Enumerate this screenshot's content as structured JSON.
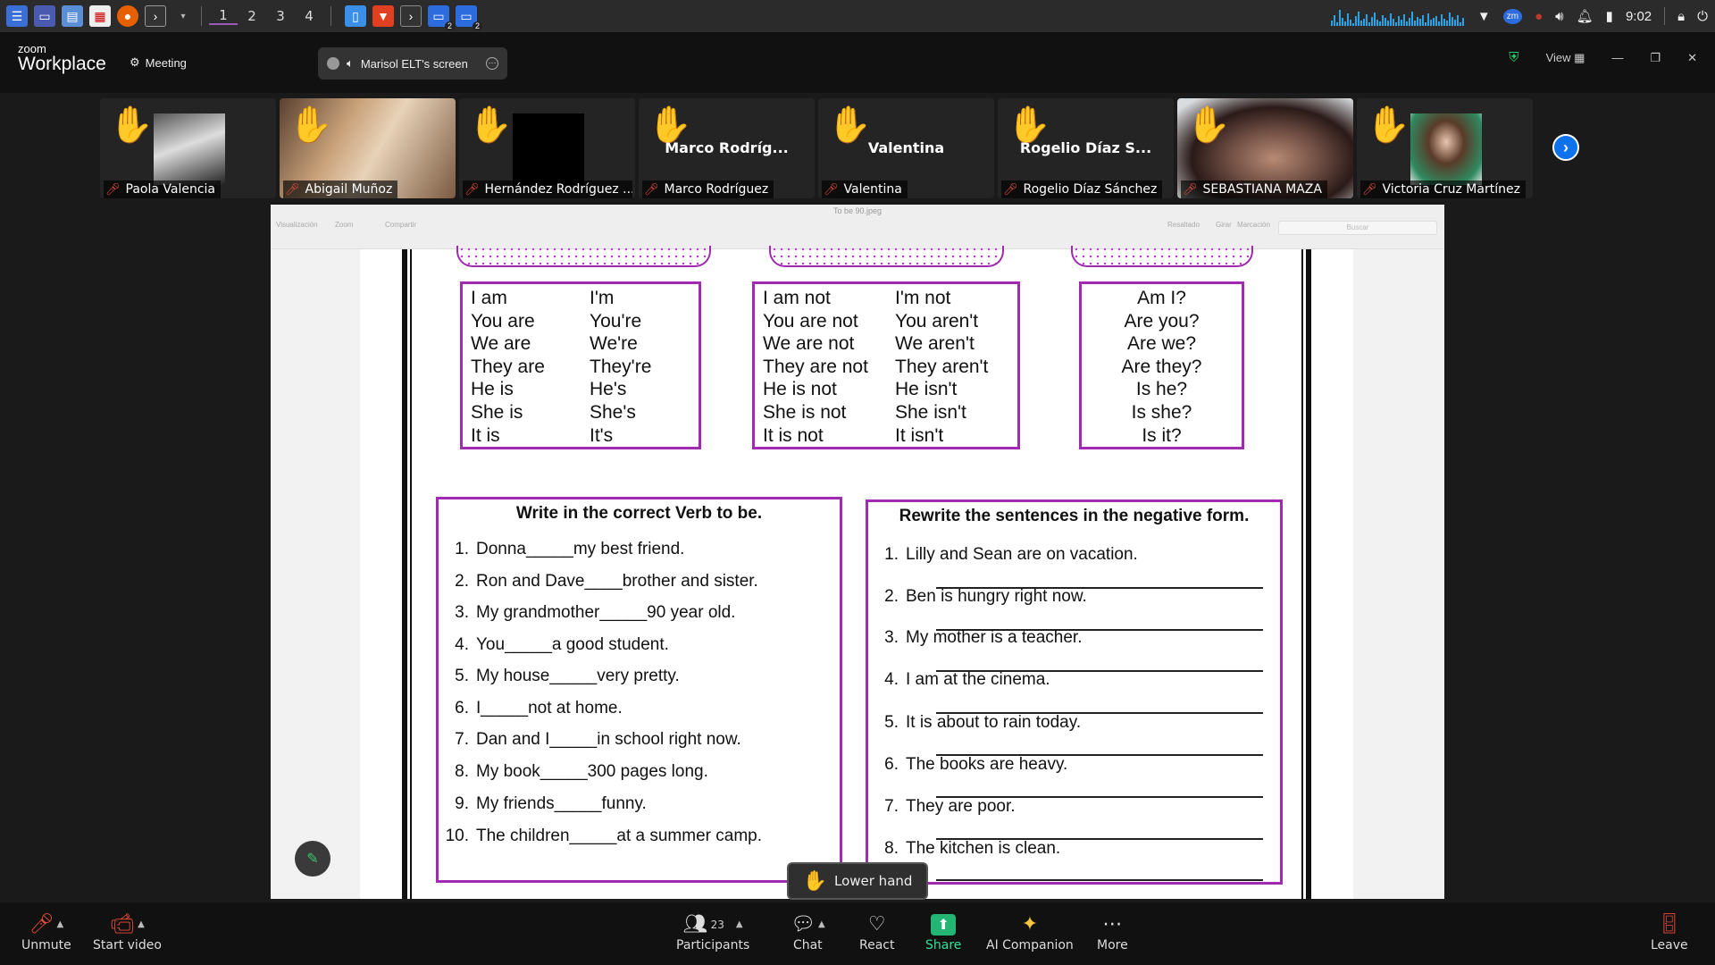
{
  "os_panel": {
    "workspaces": [
      "1",
      "2",
      "3",
      "4"
    ],
    "active_workspace": "1",
    "badges": [
      "2",
      "2"
    ],
    "clock": "9:02",
    "tray_icons": [
      "wifi-icon",
      "zoom-tray-icon",
      "volume-icon",
      "bell-icon",
      "battery-icon",
      "lock-icon",
      "power-icon"
    ]
  },
  "zoom": {
    "logo_small": "zoom",
    "logo_big": "Workplace",
    "meeting_label": "Meeting",
    "share_pill_label": "Marisol ELT's screen",
    "view_label": "View"
  },
  "participants": [
    {
      "name": "Paola Valencia",
      "hand": true,
      "video": "photo-dark"
    },
    {
      "name": "Abigail Muñoz",
      "hand": true,
      "video": "photo-hair"
    },
    {
      "name": "Hernández Rodríguez ...",
      "hand": true,
      "video": "black"
    },
    {
      "name": "Marco Rodríguez",
      "hand": true,
      "big_name": "Marco Rodríg..."
    },
    {
      "name": "Valentina",
      "hand": true,
      "big_name": "Valentina"
    },
    {
      "name": "Rogelio Díaz Sánchez",
      "hand": true,
      "big_name": "Rogelio Díaz S..."
    },
    {
      "name": "SEBASTIANA MAZA",
      "hand": true,
      "video": "photo-face"
    },
    {
      "name": "Victoria Cruz Martínez",
      "hand": true,
      "video": "photo-portrait"
    }
  ],
  "viewer": {
    "file_title": "To be 90.jpeg",
    "tools": [
      "Visualización",
      "Zoom",
      "Compartir",
      "Resaltado",
      "Girar",
      "Marcación",
      "Buscar"
    ],
    "search_placeholder": "Buscar"
  },
  "worksheet": {
    "affirmative": {
      "full": [
        "I am",
        "You are",
        "We are",
        "They are",
        "He is",
        "She is",
        "It is"
      ],
      "short": [
        "I'm",
        "You're",
        "We're",
        "They're",
        "He's",
        "She's",
        "It's"
      ]
    },
    "negative": {
      "full": [
        "I am not",
        "You are not",
        "We are not",
        "They are not",
        "He is not",
        "She is not",
        "It is not"
      ],
      "short": [
        "I'm not",
        "You aren't",
        "We aren't",
        "They aren't",
        "He isn't",
        "She isn't",
        "It isn't"
      ]
    },
    "questions": [
      "Am I?",
      "Are you?",
      "Are we?",
      "Are they?",
      "Is he?",
      "Is she?",
      "Is it?"
    ],
    "exercise1": {
      "title": "Write in the correct Verb to be.",
      "items": [
        {
          "n": "1.",
          "t": "Donna_____my best friend."
        },
        {
          "n": "2.",
          "t": "Ron and Dave____brother and sister."
        },
        {
          "n": "3.",
          "t": "My grandmother_____90 year old."
        },
        {
          "n": "4.",
          "t": "You_____a good student."
        },
        {
          "n": "5.",
          "t": "My house_____very pretty."
        },
        {
          "n": "6.",
          "t": "I_____not at home."
        },
        {
          "n": "7.",
          "t": "Dan and I_____in school right now."
        },
        {
          "n": "8.",
          "t": "My book_____300 pages long."
        },
        {
          "n": "9.",
          "t": "My friends_____funny."
        },
        {
          "n": "10.",
          "t": "The children_____at a summer camp."
        }
      ]
    },
    "exercise2": {
      "title": "Rewrite the sentences in the negative form.",
      "items": [
        {
          "n": "1.",
          "t": "Lilly and Sean are on vacation."
        },
        {
          "n": "2.",
          "t": "Ben is hungry right now."
        },
        {
          "n": "3.",
          "t": "My mother is a teacher."
        },
        {
          "n": "4.",
          "t": "I am at the cinema."
        },
        {
          "n": "5.",
          "t": "It is about to rain today."
        },
        {
          "n": "6.",
          "t": "The books are heavy."
        },
        {
          "n": "7.",
          "t": "They are poor."
        },
        {
          "n": "8.",
          "t": "The kitchen is clean."
        }
      ]
    }
  },
  "lower_hand_label": "Lower hand",
  "toolbar": {
    "unmute": "Unmute",
    "start_video": "Start video",
    "participants": "Participants",
    "participants_count": "23",
    "chat": "Chat",
    "react": "React",
    "share": "Share",
    "ai": "AI Companion",
    "more": "More",
    "leave": "Leave"
  },
  "colors": {
    "worksheet_border": "#a02ab0",
    "hand": "#f5a623",
    "share_green": "#22b573",
    "zoom_blue": "#0e72ed"
  }
}
